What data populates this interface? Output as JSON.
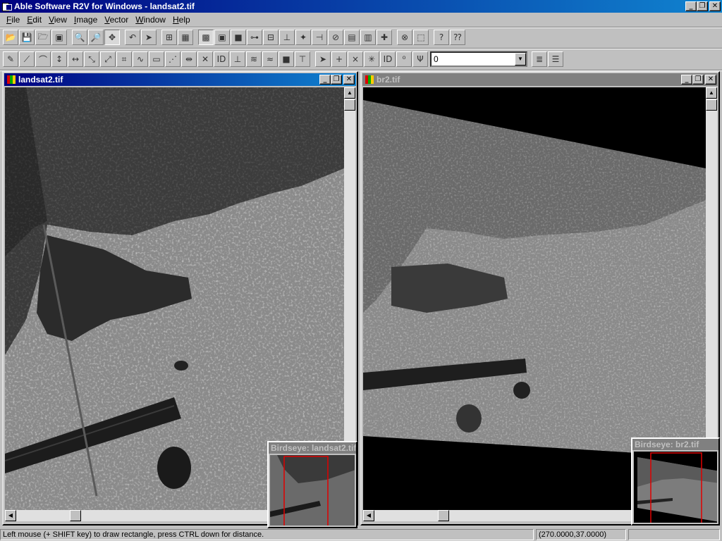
{
  "app": {
    "title": "Able Software R2V for Windows - landsat2.tif"
  },
  "window_controls": {
    "minimize": "_",
    "restore": "❐",
    "close": "✕"
  },
  "menu": [
    "File",
    "Edit",
    "View",
    "Image",
    "Vector",
    "Window",
    "Help"
  ],
  "toolbar1": [
    {
      "name": "open-icon",
      "glyph": "📂"
    },
    {
      "name": "save-icon",
      "glyph": "💾"
    },
    {
      "name": "open-project-icon",
      "glyph": "🗁"
    },
    {
      "name": "save-project-icon",
      "glyph": "▣"
    },
    {
      "name": "zoom-in-icon",
      "glyph": "🔍"
    },
    {
      "name": "zoom-out-icon",
      "glyph": "🔎"
    },
    {
      "name": "pan-icon",
      "glyph": "✥"
    },
    {
      "name": "undo-icon",
      "glyph": "↶"
    },
    {
      "name": "select-arrow-icon",
      "glyph": "➤"
    },
    {
      "name": "grid-icon",
      "glyph": "⊞"
    },
    {
      "name": "table-icon",
      "glyph": "▦"
    },
    {
      "name": "image-view-icon",
      "glyph": "▩"
    },
    {
      "name": "image-frame-icon",
      "glyph": "▣"
    },
    {
      "name": "green-box-icon",
      "glyph": "■"
    },
    {
      "name": "node-line-icon",
      "glyph": "⊶"
    },
    {
      "name": "segment-icon",
      "glyph": "⊟"
    },
    {
      "name": "split-icon",
      "glyph": "⊥"
    },
    {
      "name": "point-icon",
      "glyph": "✦"
    },
    {
      "name": "join-icon",
      "glyph": "⊣"
    },
    {
      "name": "no-icon",
      "glyph": "⊘"
    },
    {
      "name": "label-icon",
      "glyph": "▤"
    },
    {
      "name": "measure-icon",
      "glyph": "▥"
    },
    {
      "name": "cross-icon",
      "glyph": "✚"
    },
    {
      "name": "pick-icon",
      "glyph": "⊗"
    },
    {
      "name": "select-tool-icon",
      "glyph": "⬚"
    },
    {
      "name": "help-icon",
      "glyph": "?"
    },
    {
      "name": "context-help-icon",
      "glyph": "⁇"
    }
  ],
  "toolbar2": [
    {
      "name": "pen-icon",
      "glyph": "✎"
    },
    {
      "name": "line-icon",
      "glyph": "⟋"
    },
    {
      "name": "arc-icon",
      "glyph": "⌒"
    },
    {
      "name": "vertical-icon",
      "glyph": "↕"
    },
    {
      "name": "horizontal-icon",
      "glyph": "↔"
    },
    {
      "name": "diag-icon",
      "glyph": "⤡"
    },
    {
      "name": "diag2-icon",
      "glyph": "⤢"
    },
    {
      "name": "grid-node-icon",
      "glyph": "⌗"
    },
    {
      "name": "curve-icon",
      "glyph": "∿"
    },
    {
      "name": "rect-icon",
      "glyph": "▭"
    },
    {
      "name": "polyline-icon",
      "glyph": "⋰"
    },
    {
      "name": "move-node-icon",
      "glyph": "⇹"
    },
    {
      "name": "delete-node-icon",
      "glyph": "✕"
    },
    {
      "name": "id-icon",
      "glyph": "ID"
    },
    {
      "name": "id-line-icon",
      "glyph": "⊥"
    },
    {
      "name": "contour-icon",
      "glyph": "≋"
    },
    {
      "name": "smooth-icon",
      "glyph": "≈"
    },
    {
      "name": "fill-icon",
      "glyph": "■"
    },
    {
      "name": "snap-icon",
      "glyph": "⊤"
    },
    {
      "name": "select-node-icon",
      "glyph": "➤"
    },
    {
      "name": "add-node-icon",
      "glyph": "+"
    },
    {
      "name": "remove-node-icon",
      "glyph": "×"
    },
    {
      "name": "star-node-icon",
      "glyph": "✳"
    },
    {
      "name": "id-node-icon",
      "glyph": "ID"
    },
    {
      "name": "node-value-icon",
      "glyph": "⁰"
    },
    {
      "name": "fork-icon",
      "glyph": "Ψ"
    }
  ],
  "combo": {
    "value": "0",
    "arrow": "▼"
  },
  "toolbar2_tail": [
    {
      "name": "layers-icon",
      "glyph": "≣"
    },
    {
      "name": "layer-props-icon",
      "glyph": "☰"
    }
  ],
  "windows": {
    "left": {
      "title": "landsat2.tif",
      "birdseye_title": "Birdseye: landsat2.tif"
    },
    "right": {
      "title": "br2.tif",
      "birdseye_title": "Birdseye: br2.tif"
    }
  },
  "scroll": {
    "up": "▲",
    "down": "▼",
    "left": "◀",
    "right": "▶"
  },
  "status": {
    "message": "Left mouse (+ SHIFT key) to draw rectangle, press CTRL down for distance.",
    "coords": "(270.0000,37.0000)"
  }
}
